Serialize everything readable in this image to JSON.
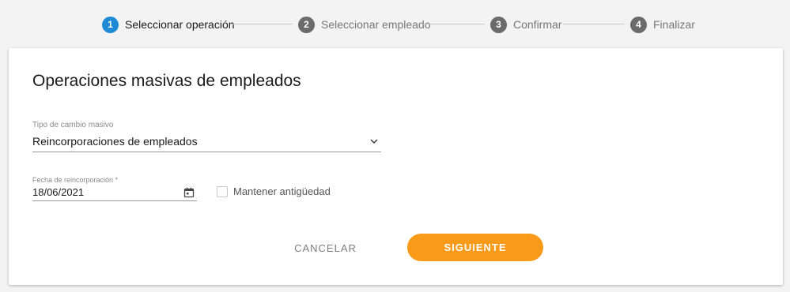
{
  "stepper": {
    "steps": [
      {
        "number": "1",
        "label": "Seleccionar operación",
        "state": "active"
      },
      {
        "number": "2",
        "label": "Seleccionar empleado",
        "state": "pending"
      },
      {
        "number": "3",
        "label": "Confirmar",
        "state": "pending"
      },
      {
        "number": "4",
        "label": "Finalizar",
        "state": "pending"
      }
    ],
    "active_color": "#1e8ad6",
    "pending_color": "#6b6b6b"
  },
  "form": {
    "title": "Operaciones masivas de empleados",
    "change_type": {
      "label": "Tipo de cambio masivo",
      "value": "Reincorporaciones de empleados"
    },
    "rejoin_date": {
      "label": "Fecha de reincorporación *",
      "value": "18/06/2021"
    },
    "keep_seniority": {
      "label": "Mantener antigüedad",
      "checked": false
    },
    "buttons": {
      "cancel": "CANCELAR",
      "next": "SIGUIENTE"
    },
    "accent_color": "#f99a19"
  }
}
